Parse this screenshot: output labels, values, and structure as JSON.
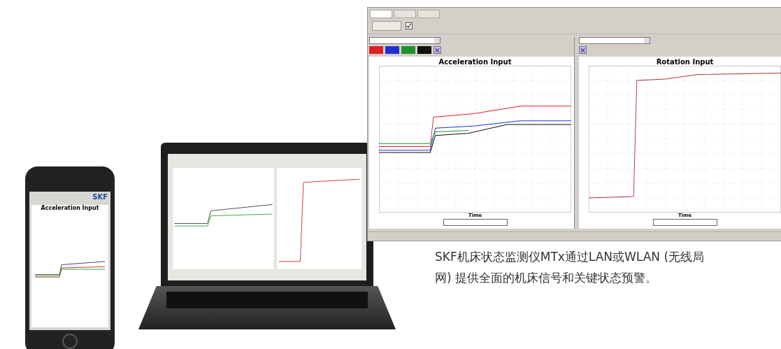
{
  "screenshot_window": {
    "tabs": [
      {
        "selected": true
      },
      {
        "selected": false
      },
      {
        "selected": false
      }
    ],
    "toolbar_checkbox": {
      "checked": true
    },
    "panels": [
      {
        "title": "Acceleration Input",
        "x_axis_label": "Time",
        "toggles": [
          {
            "color": "#e02020"
          },
          {
            "color": "#2030d0"
          },
          {
            "color": "#20902a"
          },
          {
            "color": "#111111"
          }
        ]
      },
      {
        "title": "Rotation Input",
        "x_axis_label": "Time"
      }
    ]
  },
  "phone": {
    "logo": "SKF",
    "chart_title": "Acceleration Input"
  },
  "caption": {
    "lines": [
      "SKF机床状态监测仪MTx通过LAN或WLAN (无线局",
      "网) 提供全面的机床信号和关键状态预警。"
    ]
  }
}
